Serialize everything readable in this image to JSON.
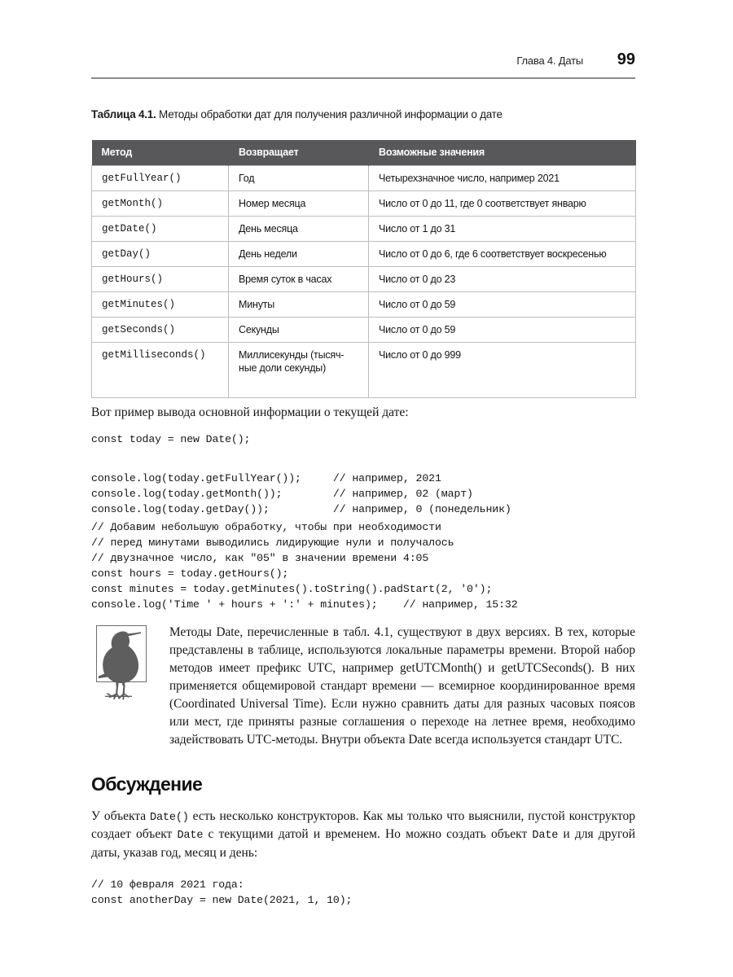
{
  "page": {
    "running_head_chapter": "Глава 4. Даты",
    "folio": "99"
  },
  "table_caption": {
    "label": "Таблица 4.1.",
    "text": " Методы обработки дат для получения различной информации о дате"
  },
  "table": {
    "headers": [
      "Метод",
      "Возвращает",
      "Возможные значения"
    ],
    "rows": [
      {
        "method": "getFullYear()",
        "returns": "Год",
        "values": "Четырехзначное число, например 2021"
      },
      {
        "method": "getMonth()",
        "returns": "Номер месяца",
        "values": "Число от 0 до 11, где 0 соответствует январю"
      },
      {
        "method": "getDate()",
        "returns": "День месяца",
        "values": "Число от 1 до 31"
      },
      {
        "method": "getDay()",
        "returns": "День недели",
        "values": "Число от 0 до 6, где 6 соответствует воскресенью"
      },
      {
        "method": "getHours()",
        "returns": "Время суток в часах",
        "values": "Число от 0 до 23"
      },
      {
        "method": "getMinutes()",
        "returns": "Минуты",
        "values": "Число от 0 до 59"
      },
      {
        "method": "getSeconds()",
        "returns": "Секунды",
        "values": "Число от 0 до 59"
      },
      {
        "method": "getMilliseconds()",
        "returns": "Миллисекунды (тысяч-\nные доли секунды)",
        "values": "Число от 0 до 999"
      }
    ]
  },
  "intro_paragraph": "Вот пример вывода основной информации о текущей дате:",
  "code_block_1": "const today = new Date();",
  "code_block_2": "console.log(today.getFullYear());     // например, 2021\nconsole.log(today.getMonth());        // например, 02 (март)\nconsole.log(today.getDay());          // например, 0 (понедельник)",
  "code_block_3": "// Добавим небольшую обработку, чтобы при необходимости\n// перед минутами выводились лидирующие нули и получалось\n// двузначное число, как \"05\" в значении времени 4:05\nconst hours = today.getHours();\nconst minutes = today.getMinutes().toString().padStart(2, '0');\nconsole.log('Time ' + hours + ':' + minutes);    // например, 15:32",
  "note": {
    "icon_name": "raven-icon",
    "text": "Методы Date, перечисленные в табл. 4.1, существуют в двух версиях. В тех, которые представлены в таблице, используются локальные параметры времени. Второй набор методов имеет префикс UTC, например getUTCMonth() и getUTCSeconds(). В них применяется общемировой стандарт времени — всемирное координированное время (Coordinated Universal Time). Если нужно сравнить даты для разных часовых поясов или мест, где приняты разные соглашения о переходе на летнее время, необходимо задействовать UTC-методы. Внутри объекта Date всегда используется стандарт UTC."
  },
  "section": {
    "heading": "Обсуждение",
    "paragraph_part_1": "У объекта ",
    "paragraph_code_1": "Date()",
    "paragraph_part_2": " есть несколько конструкторов. Как мы только что выяснили, пустой конструктор создает объект ",
    "paragraph_code_2": "Date",
    "paragraph_part_3": " с текущими датой и временем. Но можно создать объект ",
    "paragraph_code_3": "Date",
    "paragraph_part_4": " и для другой даты, указав год, месяц и день:"
  },
  "code_block_4": "// 10 февраля 2021 года:\nconst anotherDay = new Date(2021, 1, 10);",
  "colors": {
    "table_header_bg": "#58585a",
    "table_border": "#bdbdbd",
    "rule": "#8a8a8a",
    "text": "#141414"
  }
}
